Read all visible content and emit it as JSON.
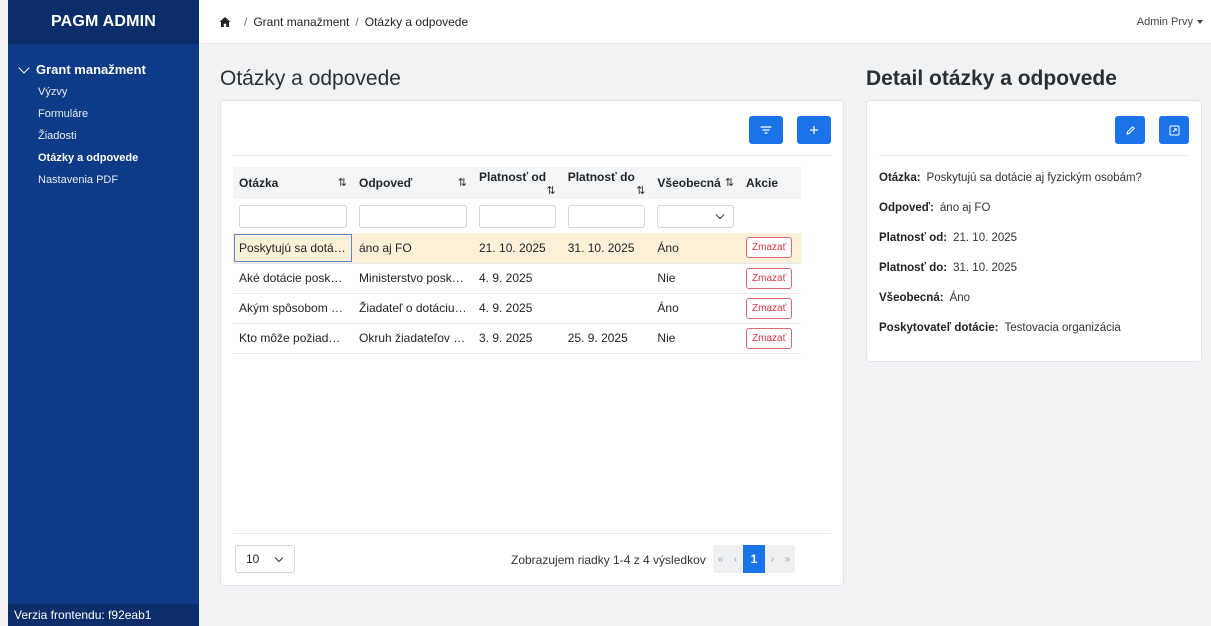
{
  "sidebar": {
    "brand": "PAGM ADMIN",
    "group": "Grant manažment",
    "items": [
      {
        "label": "Výzvy",
        "active": false
      },
      {
        "label": "Formuláre",
        "active": false
      },
      {
        "label": "Žiadosti",
        "active": false
      },
      {
        "label": "Otázky a odpovede",
        "active": true
      },
      {
        "label": "Nastavenia PDF",
        "active": false
      }
    ],
    "version": "Verzia frontendu: f92eab1"
  },
  "topbar": {
    "breadcrumb": [
      "Grant manažment",
      "Otázky a odpovede"
    ],
    "user": "Admin Prvy"
  },
  "main": {
    "title": "Otázky a odpovede",
    "filter_icon": "filter-icon",
    "add_icon": "plus-icon",
    "table": {
      "columns": [
        "Otázka",
        "Odpoveď",
        "Platnosť od",
        "Platnosť do",
        "Všeobecná",
        "Akcie"
      ],
      "sort_glyph": "⇅",
      "rows": [
        {
          "question": "Poskytujú sa dotác…",
          "answer": "áno aj FO",
          "from": "21. 10. 2025",
          "to": "31. 10. 2025",
          "general": "Áno",
          "action": "Zmazať"
        },
        {
          "question": "Aké dotácie poskyt…",
          "answer": "Ministerstvo posky…",
          "from": "4. 9. 2025",
          "to": "",
          "general": "Nie",
          "action": "Zmazať"
        },
        {
          "question": "Akým spôsobom s…",
          "answer": "Žiadateľ o dotáciu …",
          "from": "4. 9. 2025",
          "to": "",
          "general": "Áno",
          "action": "Zmazať"
        },
        {
          "question": "Kto môže požiadať…",
          "answer": "Okruh žiadateľov o…",
          "from": "3. 9. 2025",
          "to": "25. 9. 2025",
          "general": "Nie",
          "action": "Zmazať"
        }
      ]
    },
    "page_size": "10",
    "page_info": "Zobrazujem riadky 1-4 z 4 výsledkov",
    "pager": {
      "first": "«",
      "prev": "‹",
      "current": "1",
      "next": "›",
      "last": "»"
    }
  },
  "detail": {
    "title": "Detail otázky a odpovede",
    "edit_icon": "pencil-icon",
    "open_icon": "external-link-icon",
    "fields": [
      {
        "label": "Otázka:",
        "value": "Poskytujú sa dotácie aj fyzickým osobám?"
      },
      {
        "label": "Odpoveď:",
        "value": "áno aj FO"
      },
      {
        "label": "Platnosť od:",
        "value": "21. 10. 2025"
      },
      {
        "label": "Platnosť do:",
        "value": "31. 10. 2025"
      },
      {
        "label": "Všeobecná:",
        "value": "Áno"
      },
      {
        "label": "Poskytovateľ dotácie:",
        "value": "Testovacia organizácia"
      }
    ]
  },
  "colors": {
    "sidebar": "#0d3b87",
    "brand_bar": "#0b2e6a",
    "primary": "#1a73e8",
    "selected_row": "#fdf0d8",
    "danger": "#d93846"
  }
}
